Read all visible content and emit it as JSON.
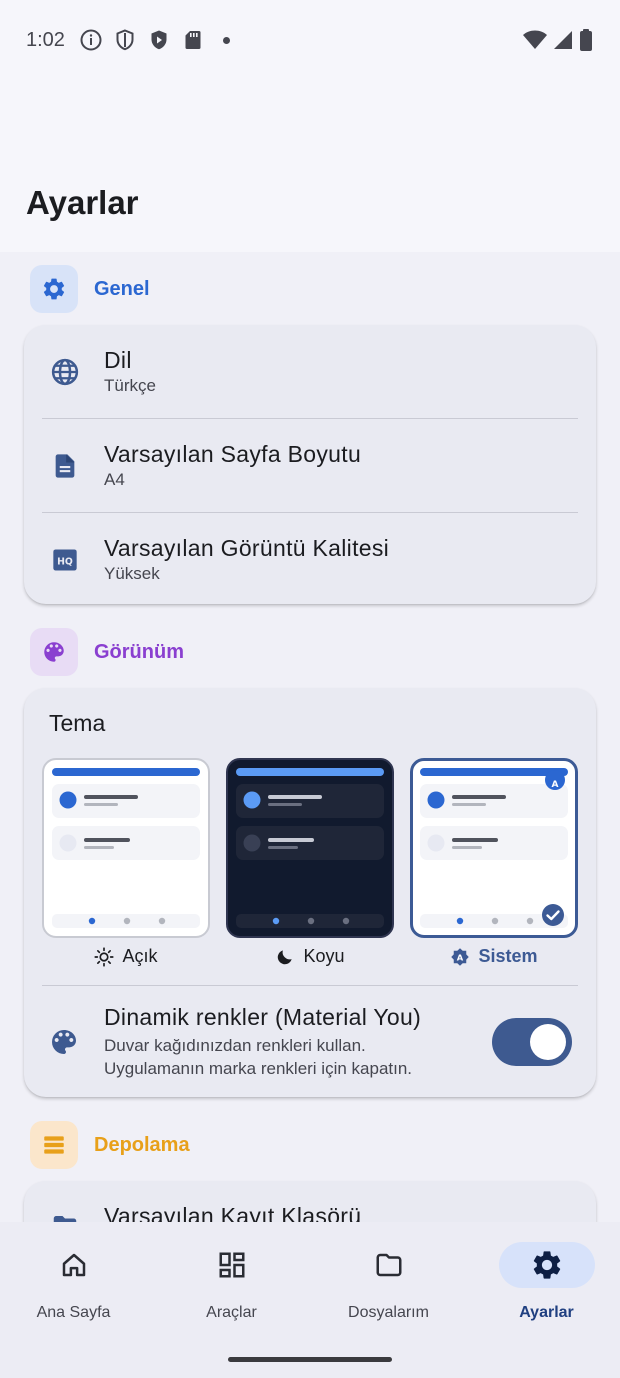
{
  "status_bar": {
    "time": "1:02",
    "left_icons": [
      "info-icon",
      "shield-icon",
      "vpn-shield-icon",
      "sd-card-icon",
      "notification-dot"
    ],
    "right_icons": [
      "wifi-icon",
      "cell-signal-icon",
      "battery-icon"
    ]
  },
  "page": {
    "title": "Ayarlar"
  },
  "sections": {
    "general": {
      "label": "Genel",
      "icon": "gear-icon",
      "color": "#2b67d1",
      "items": [
        {
          "icon": "globe-icon",
          "title": "Dil",
          "subtitle": "Türkçe"
        },
        {
          "icon": "document-icon",
          "title": "Varsayılan Sayfa Boyutu",
          "subtitle": "A4"
        },
        {
          "icon": "hq-icon",
          "title": "Varsayılan Görüntü Kalitesi",
          "subtitle": "Yüksek"
        }
      ]
    },
    "appearance": {
      "label": "Görünüm",
      "icon": "palette-icon",
      "color": "#8a3fd0",
      "theme_title": "Tema",
      "themes": [
        {
          "label": "Açık",
          "icon": "sun-icon",
          "selected": false
        },
        {
          "label": "Koyu",
          "icon": "moon-icon",
          "selected": false
        },
        {
          "label": "Sistem",
          "icon": "auto-brightness-icon",
          "selected": true
        }
      ],
      "dynamic_colors": {
        "icon": "palette-icon",
        "title": "Dinamik renkler (Material You)",
        "subtitle_line1": "Duvar kağıdınızdan renkleri kullan.",
        "subtitle_line2": "Uygulamanın marka renkleri için kapatın.",
        "enabled": true
      }
    },
    "storage": {
      "label": "Depolama",
      "icon": "storage-icon",
      "color": "#e8a01a",
      "items": [
        {
          "icon": "folder-icon",
          "title": "Varsayılan Kayıt Klasörü"
        }
      ]
    }
  },
  "bottom_nav": {
    "items": [
      {
        "label": "Ana Sayfa",
        "icon": "home-icon",
        "active": false
      },
      {
        "label": "Araçlar",
        "icon": "grid-tools-icon",
        "active": false
      },
      {
        "label": "Dosyalarım",
        "icon": "folder-icon",
        "active": false
      },
      {
        "label": "Ayarlar",
        "icon": "gear-icon",
        "active": true
      }
    ]
  },
  "colors": {
    "accent": "#3e5a90",
    "active_nav_bg": "#d7e2fa",
    "card_bg": "#e9eaf2",
    "page_bg": "#f0f0f7"
  }
}
